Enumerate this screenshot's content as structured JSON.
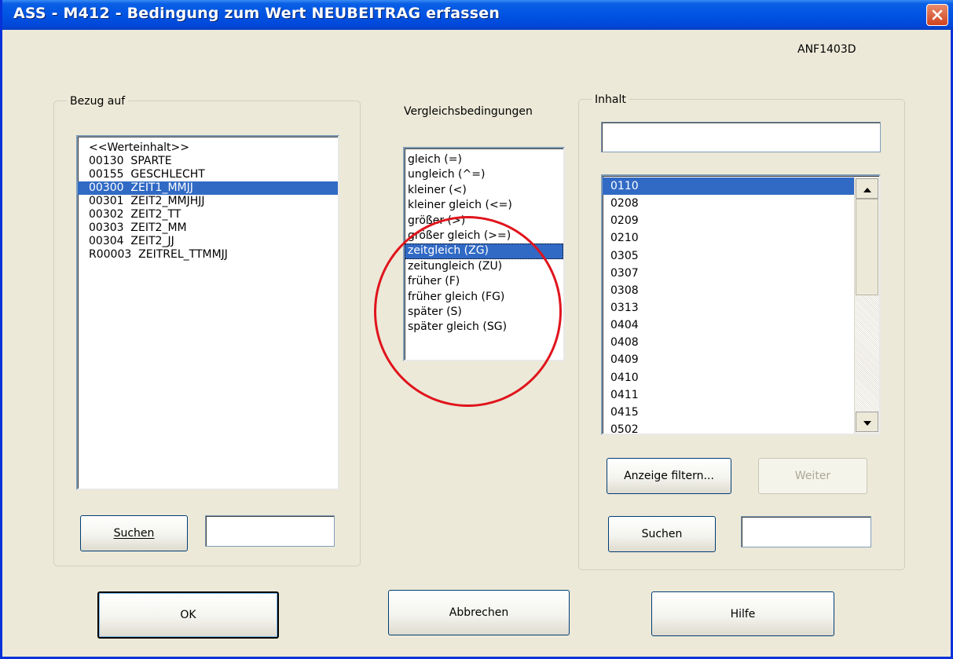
{
  "window": {
    "title": "ASS - M412 - Bedingung zum Wert NEUBEITRAG erfassen",
    "code": "ANF1403D"
  },
  "bezug": {
    "legend": "Bezug auf",
    "items": [
      "<<Werteinhalt>>",
      "00130  SPARTE",
      "00155  GESCHLECHT",
      "00300  ZEIT1_MMJJ",
      "00301  ZEIT2_MMJHJJ",
      "00302  ZEIT2_TT",
      "00303  ZEIT2_MM",
      "00304  ZEIT2_JJ",
      "R00003  ZEITREL_TTMMJJ"
    ],
    "selected": "00300  ZEIT1_MMJJ",
    "search_label": "Suchen",
    "search_value": ""
  },
  "vergleich": {
    "label": "Vergleichsbedingungen",
    "items": [
      "gleich (=)",
      "ungleich (^=)",
      "kleiner (<)",
      "kleiner gleich (<=)",
      "größer (>)",
      "größer gleich (>=)",
      "zeitgleich (ZG)",
      "zeitungleich (ZU)",
      "früher (F)",
      "früher gleich (FG)",
      "später (S)",
      "später gleich (SG)"
    ],
    "selected": "zeitgleich (ZG)"
  },
  "inhalt": {
    "legend": "Inhalt",
    "value": "",
    "items": [
      "0110",
      "0208",
      "0209",
      "0210",
      "0305",
      "0307",
      "0308",
      "0313",
      "0404",
      "0408",
      "0409",
      "0410",
      "0411",
      "0415",
      "0502"
    ],
    "selected": "0110",
    "filter_label": "Anzeige filtern...",
    "weiter_label": "Weiter",
    "search_label": "Suchen",
    "search_value": ""
  },
  "buttons": {
    "ok": "OK",
    "abbrechen": "Abbrechen",
    "hilfe": "Hilfe"
  },
  "colors": {
    "selection": "#316ac5",
    "dialog_bg": "#ece9d8",
    "annotation": "#e0141c",
    "titlebar": "#0054e3"
  },
  "icons": {
    "close": "close-icon",
    "scroll_up": "scroll-up-icon",
    "scroll_down": "scroll-down-icon"
  }
}
